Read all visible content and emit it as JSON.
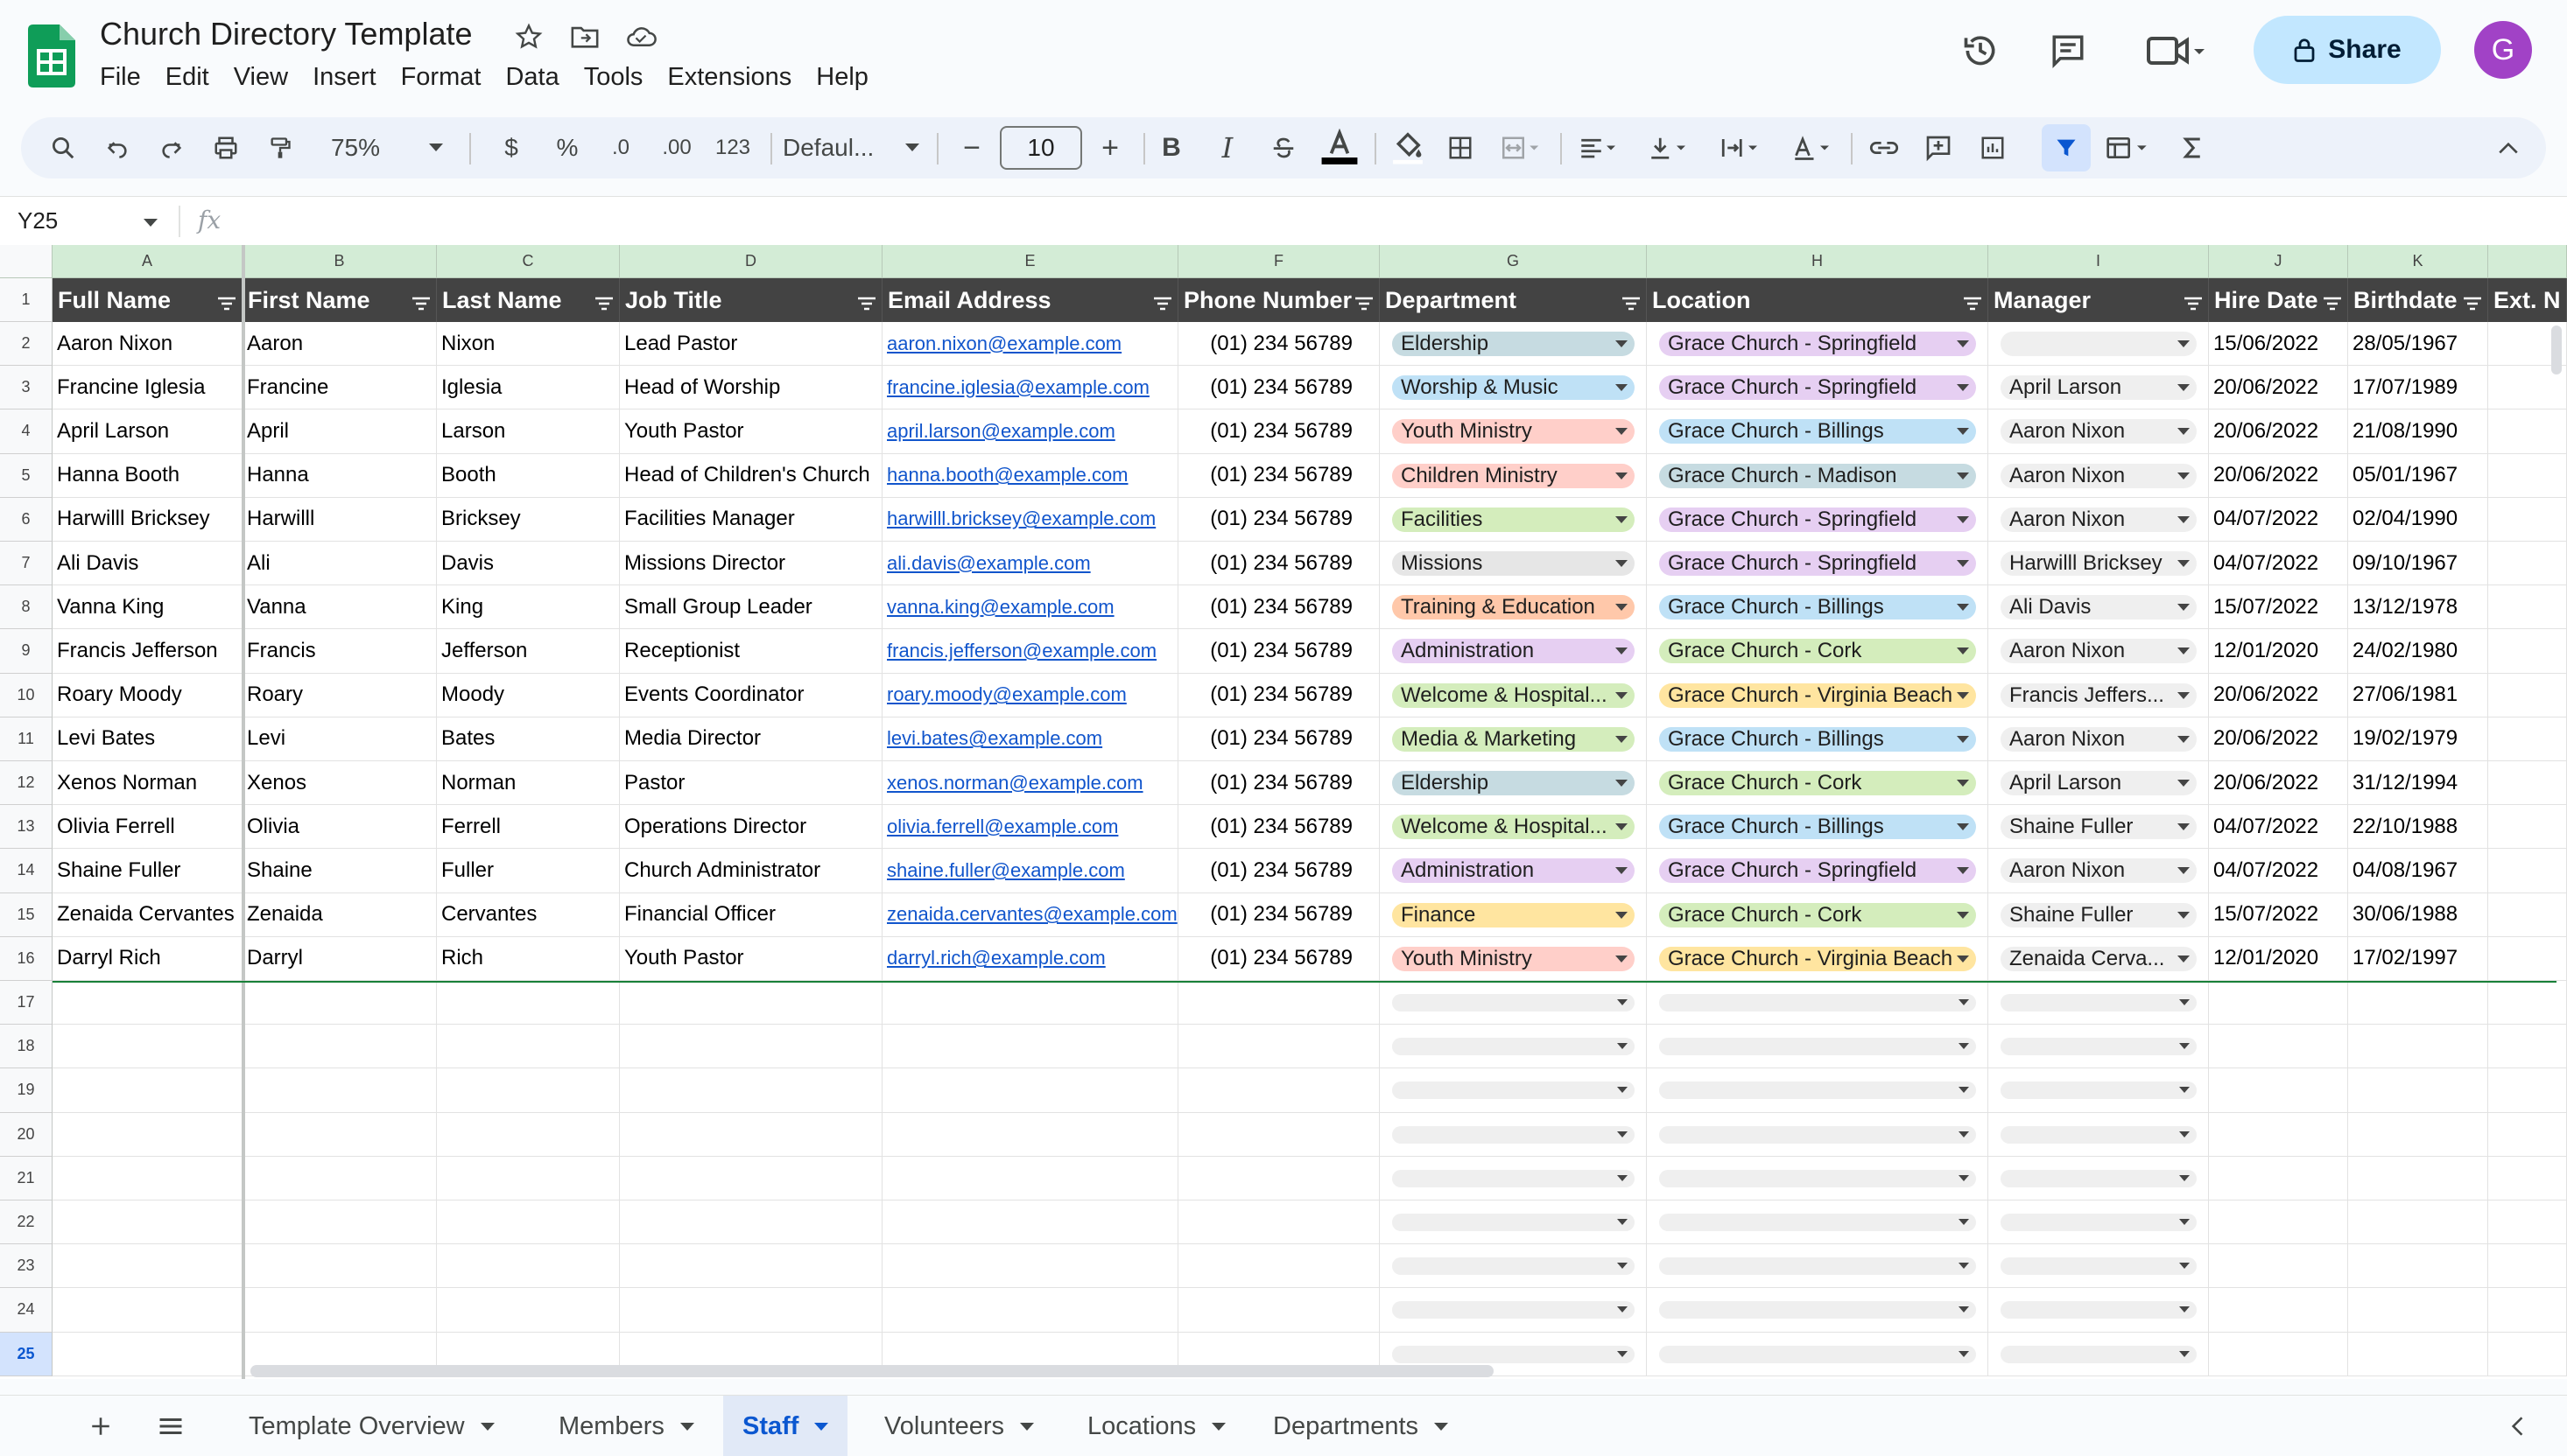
{
  "app": {
    "title": "Church Directory Template",
    "menu": [
      "File",
      "Edit",
      "View",
      "Insert",
      "Format",
      "Data",
      "Tools",
      "Extensions",
      "Help"
    ],
    "share_label": "Share",
    "avatar_initial": "G"
  },
  "toolbar": {
    "zoom": "75%",
    "currency": "$",
    "percent": "%",
    "dec_decrease": ".0",
    "dec_increase": ".00",
    "number_format": "123",
    "font": "Defaul...",
    "font_size": "10",
    "minus": "−",
    "plus": "+",
    "bold": "B",
    "italic": "I"
  },
  "formula_bar": {
    "cell_ref": "Y25",
    "fx": "fx",
    "content": ""
  },
  "grid": {
    "column_letters": [
      "A",
      "B",
      "C",
      "D",
      "E",
      "F",
      "G",
      "H",
      "I",
      "J",
      "K"
    ],
    "row_numbers": [
      "1",
      "2",
      "3",
      "4",
      "5",
      "6",
      "7",
      "8",
      "9",
      "10",
      "11",
      "12",
      "13",
      "14",
      "15",
      "16",
      "17",
      "18",
      "19",
      "20",
      "21",
      "22",
      "23",
      "24",
      "25"
    ],
    "headers": [
      "Full Name",
      "First Name",
      "Last Name",
      "Job Title",
      "Email Address",
      "Phone Number",
      "Department",
      "Location",
      "Manager",
      "Hire Date",
      "Birthdate",
      "Ext. N"
    ],
    "rows": [
      {
        "full": "Aaron Nixon",
        "first": "Aaron",
        "last": "Nixon",
        "job": "Lead Pastor",
        "email": "aaron.nixon@example.com",
        "phone": "(01) 234 56789",
        "dept": "Eldership",
        "loc": "Grace Church - Springfield",
        "mgr": "",
        "hire": "15/06/2022",
        "birth": "28/05/1967"
      },
      {
        "full": "Francine Iglesia",
        "first": "Francine",
        "last": "Iglesia",
        "job": "Head of Worship",
        "email": "francine.iglesia@example.com",
        "phone": "(01) 234 56789",
        "dept": "Worship & Music",
        "loc": "Grace Church - Springfield",
        "mgr": "April Larson",
        "hire": "20/06/2022",
        "birth": "17/07/1989"
      },
      {
        "full": "April Larson",
        "first": "April",
        "last": "Larson",
        "job": "Youth Pastor",
        "email": "april.larson@example.com",
        "phone": "(01) 234 56789",
        "dept": "Youth Ministry",
        "loc": "Grace Church - Billings",
        "mgr": "Aaron Nixon",
        "hire": "20/06/2022",
        "birth": "21/08/1990"
      },
      {
        "full": "Hanna Booth",
        "first": "Hanna",
        "last": "Booth",
        "job": "Head of Children's Church",
        "email": "hanna.booth@example.com",
        "phone": "(01) 234 56789",
        "dept": "Children Ministry",
        "loc": "Grace Church - Madison",
        "mgr": "Aaron Nixon",
        "hire": "20/06/2022",
        "birth": "05/01/1967"
      },
      {
        "full": "Harwilll Bricksey",
        "first": "Harwilll",
        "last": "Bricksey",
        "job": "Facilities Manager",
        "email": "harwilll.bricksey@example.com",
        "phone": "(01) 234 56789",
        "dept": "Facilities",
        "loc": "Grace Church - Springfield",
        "mgr": "Aaron Nixon",
        "hire": "04/07/2022",
        "birth": "02/04/1990"
      },
      {
        "full": "Ali Davis",
        "first": "Ali",
        "last": "Davis",
        "job": "Missions Director",
        "email": "ali.davis@example.com",
        "phone": "(01) 234 56789",
        "dept": "Missions",
        "loc": "Grace Church - Springfield",
        "mgr": "Harwilll Bricksey",
        "hire": "04/07/2022",
        "birth": "09/10/1967"
      },
      {
        "full": "Vanna King",
        "first": "Vanna",
        "last": "King",
        "job": "Small Group Leader",
        "email": "vanna.king@example.com",
        "phone": "(01) 234 56789",
        "dept": "Training & Education",
        "loc": "Grace Church - Billings",
        "mgr": "Ali Davis",
        "hire": "15/07/2022",
        "birth": "13/12/1978"
      },
      {
        "full": "Francis Jefferson",
        "first": "Francis",
        "last": "Jefferson",
        "job": "Receptionist",
        "email": "francis.jefferson@example.com",
        "phone": "(01) 234 56789",
        "dept": "Administration",
        "loc": "Grace Church - Cork",
        "mgr": "Aaron Nixon",
        "hire": "12/01/2020",
        "birth": "24/02/1980"
      },
      {
        "full": "Roary Moody",
        "first": "Roary",
        "last": "Moody",
        "job": "Events Coordinator",
        "email": "roary.moody@example.com",
        "phone": "(01) 234 56789",
        "dept": "Welcome & Hospital...",
        "loc": "Grace Church - Virginia Beach",
        "mgr": "Francis Jeffers...",
        "hire": "20/06/2022",
        "birth": "27/06/1981"
      },
      {
        "full": "Levi Bates",
        "first": "Levi",
        "last": "Bates",
        "job": "Media Director",
        "email": "levi.bates@example.com",
        "phone": "(01) 234 56789",
        "dept": "Media & Marketing",
        "loc": "Grace Church - Billings",
        "mgr": "Aaron Nixon",
        "hire": "20/06/2022",
        "birth": "19/02/1979"
      },
      {
        "full": "Xenos Norman",
        "first": "Xenos",
        "last": "Norman",
        "job": "Pastor",
        "email": "xenos.norman@example.com",
        "phone": "(01) 234 56789",
        "dept": "Eldership",
        "loc": "Grace Church - Cork",
        "mgr": "April Larson",
        "hire": "20/06/2022",
        "birth": "31/12/1994"
      },
      {
        "full": "Olivia Ferrell",
        "first": "Olivia",
        "last": "Ferrell",
        "job": "Operations Director",
        "email": "olivia.ferrell@example.com",
        "phone": "(01) 234 56789",
        "dept": "Welcome & Hospital...",
        "loc": "Grace Church - Billings",
        "mgr": "Shaine Fuller",
        "hire": "04/07/2022",
        "birth": "22/10/1988"
      },
      {
        "full": "Shaine Fuller",
        "first": "Shaine",
        "last": "Fuller",
        "job": "Church Administrator",
        "email": "shaine.fuller@example.com",
        "phone": "(01) 234 56789",
        "dept": "Administration",
        "loc": "Grace Church - Springfield",
        "mgr": "Aaron Nixon",
        "hire": "04/07/2022",
        "birth": "04/08/1967"
      },
      {
        "full": "Zenaida Cervantes",
        "first": "Zenaida",
        "last": "Cervantes",
        "job": "Financial Officer",
        "email": "zenaida.cervantes@example.com",
        "phone": "(01) 234 56789",
        "dept": "Finance",
        "loc": "Grace Church - Cork",
        "mgr": "Shaine Fuller",
        "hire": "15/07/2022",
        "birth": "30/06/1988"
      },
      {
        "full": "Darryl Rich",
        "first": "Darryl",
        "last": "Rich",
        "job": "Youth Pastor",
        "email": "darryl.rich@example.com",
        "phone": "(01) 234 56789",
        "dept": "Youth Ministry",
        "loc": "Grace Church - Virginia Beach",
        "mgr": "Zenaida Cerva...",
        "hire": "12/01/2020",
        "birth": "17/02/1997"
      }
    ],
    "dept_colors": {
      "Eldership": "#c6dbe1",
      "Worship & Music": "#bfe1f6",
      "Youth Ministry": "#ffcfc9",
      "Children Ministry": "#ffcfc9",
      "Facilities": "#d4edbc",
      "Missions": "#e6e6e6",
      "Training & Education": "#ffc8aa",
      "Administration": "#e6cff2",
      "Welcome & Hospital...": "#d4edbc",
      "Media & Marketing": "#d4edbc",
      "Finance": "#ffe5a0"
    },
    "loc_colors": {
      "Grace Church - Springfield": "#e6cff2",
      "Grace Church - Billings": "#bfe1f6",
      "Grace Church - Madison": "#c6dbe1",
      "Grace Church - Cork": "#d4edbc",
      "Grace Church - Virginia Beach": "#ffe5a0"
    },
    "header_bg": "#434343",
    "column_header_bg": "#d3ecd6"
  },
  "sheets": {
    "tabs": [
      "Template Overview",
      "Members",
      "Staff",
      "Volunteers",
      "Locations",
      "Departments"
    ],
    "active": "Staff"
  }
}
